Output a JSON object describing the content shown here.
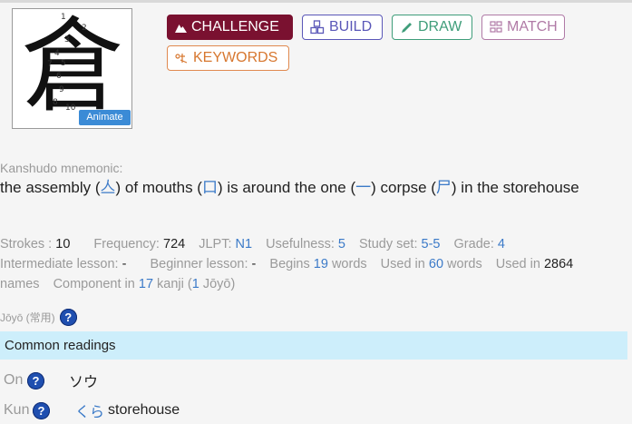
{
  "kanji": {
    "character": "倉",
    "animate_label": "Animate",
    "stroke_numbers": [
      "1",
      "2",
      "3",
      "4",
      "5",
      "6",
      "7",
      "8",
      "9",
      "10"
    ]
  },
  "buttons": {
    "challenge": "CHALLENGE",
    "build": "BUILD",
    "draw": "DRAW",
    "match": "MATCH",
    "keywords": "KEYWORDS"
  },
  "mnemonic": {
    "label": "Kanshudo mnemonic:",
    "t1": "the assembly (",
    "k1": "亼",
    "t2": ") of mouths (",
    "k2": "口",
    "t3": ") is around the one (",
    "k3": "一",
    "t4": ") corpse (",
    "k4": "尸",
    "t5": ") in the storehouse"
  },
  "stats": {
    "strokes_label": "Strokes :",
    "strokes": "10",
    "frequency_label": "Frequency:",
    "frequency": "724",
    "jlpt_label": "JLPT:",
    "jlpt": "N1",
    "usefulness_label": "Usefulness:",
    "usefulness": "5",
    "study_set_label": "Study set:",
    "study_set": "5-5",
    "grade_label": "Grade:",
    "grade": "4",
    "intermediate_label": "Intermediate lesson:",
    "intermediate": "-",
    "beginner_label": "Beginner lesson:",
    "beginner": "-",
    "begins_label": "Begins",
    "begins": "19",
    "begins_unit": "words",
    "used_label": "Used in",
    "used": "60",
    "used_unit": "words",
    "used_names_label": "Used in",
    "used_names": "2864",
    "names_unit": "names",
    "component_label": "Component in",
    "component": "17",
    "component_unit": "kanji (",
    "joyo_count": "1",
    "joyo_unit": "Jōyō)"
  },
  "joyo": {
    "label": "Jōyō (常用)",
    "help": "?"
  },
  "readings": {
    "title": "Common readings",
    "on_label": "On",
    "on_value": "ソウ",
    "kun_label": "Kun",
    "kun_kana": "くら",
    "kun_meaning": "storehouse",
    "help": "?"
  },
  "colors": {
    "challenge": "#7a1130",
    "build": "#5a57b8",
    "draw": "#3f9d7a",
    "match": "#b07aa6",
    "keywords": "#e0894f",
    "link": "#3b7ac8",
    "readings_bg": "#cdeefb",
    "help": "#1f4fb0"
  }
}
